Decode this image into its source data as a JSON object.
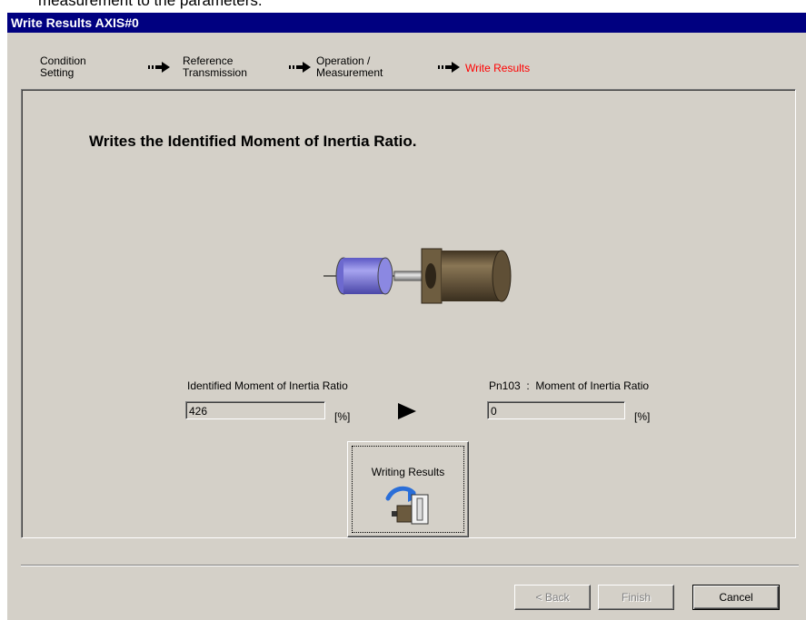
{
  "background_text": "measurement to the parameters.",
  "window": {
    "title": "Write Results AXIS#0"
  },
  "steps": [
    {
      "line1": "Condition",
      "line2": "Setting",
      "active": false
    },
    {
      "line1": "Reference",
      "line2": "Transmission",
      "active": false
    },
    {
      "line1": "Operation /",
      "line2": "Measurement",
      "active": false
    },
    {
      "line1": "Write Results",
      "line2": "",
      "active": true
    }
  ],
  "colors": {
    "active_step": "#ff0000",
    "titlebar": "#000080",
    "dialog": "#d4d0c8",
    "cylinder": "#7d7ad9",
    "motor": "#6b5a3e"
  },
  "icons": {
    "step_arrow": "right-arrow-icon",
    "transfer": "play-arrow-icon"
  },
  "main": {
    "heading": "Writes the Identified Moment of Inertia Ratio.",
    "identified": {
      "label": "Identified Moment of Inertia Ratio",
      "value": "426",
      "unit": "[%]"
    },
    "param": {
      "label": "Pn103  :  Moment of Inertia Ratio",
      "value": "0",
      "unit": "[%]"
    },
    "write_button_label": "Writing Results"
  },
  "footer": {
    "back_label": "< Back",
    "finish_label": "Finish",
    "cancel_label": "Cancel"
  }
}
